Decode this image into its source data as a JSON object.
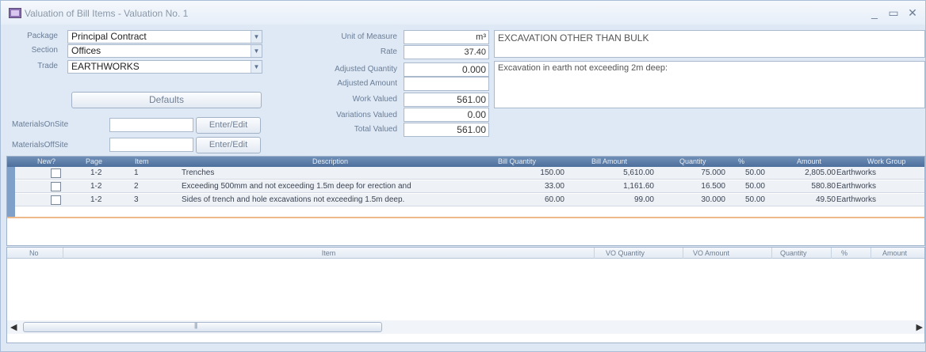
{
  "window": {
    "title": "Valuation of Bill Items - Valuation No. 1",
    "minimize": "_",
    "maximize": "▭",
    "close": "✕"
  },
  "form": {
    "package_label": "Package",
    "package_value": "Principal Contract",
    "section_label": "Section",
    "section_value": "Offices",
    "trade_label": "Trade",
    "trade_value": "EARTHWORKS",
    "defaults_button": "Defaults",
    "materials_onsite_label": "MaterialsOnSite",
    "materials_onsite_value": "",
    "materials_offsite_label": "MaterialsOffSite",
    "materials_offsite_value": "",
    "enter_edit_onsite": "Enter/Edit",
    "enter_edit_offsite": "Enter/Edit",
    "unit_label": "Unit of Measure",
    "unit_value": "m³",
    "rate_label": "Rate",
    "rate_value": "37.40",
    "adj_qty_label": "Adjusted Quantity",
    "adj_qty_value": "0.000",
    "adj_amt_label": "Adjusted Amount",
    "adj_amt_value": "",
    "work_valued_label": "Work Valued",
    "work_valued_value": "561.00",
    "variations_label": "Variations Valued",
    "variations_value": "0.00",
    "total_label": "Total Valued",
    "total_value": "561.00",
    "heading_text": "EXCAVATION OTHER THAN BULK",
    "description_text": "Excavation in earth not exceeding 2m deep:"
  },
  "bill_grid": {
    "columns": [
      "New?",
      "Page",
      "Item",
      "Description",
      "Bill Quantity",
      "Bill Amount",
      "Quantity",
      "%",
      "Amount",
      "Work Group"
    ],
    "rows": [
      {
        "page": "1-2",
        "item": "1",
        "description": "Trenches",
        "bill_qty": "150.00",
        "bill_amt": "5,610.00",
        "qty": "75.000",
        "pct": "50.00",
        "amount": "2,805.00",
        "work_group": "Earthworks"
      },
      {
        "page": "1-2",
        "item": "2",
        "description": "Exceeding 500mm and not exceeding 1.5m deep for erection and",
        "bill_qty": "33.00",
        "bill_amt": "1,161.60",
        "qty": "16.500",
        "pct": "50.00",
        "amount": "580.80",
        "work_group": "Earthworks"
      },
      {
        "page": "1-2",
        "item": "3",
        "description": "Sides of trench and hole excavations not exceeding 1.5m deep.",
        "bill_qty": "60.00",
        "bill_amt": "99.00",
        "qty": "30.000",
        "pct": "50.00",
        "amount": "49.50",
        "work_group": "Earthworks"
      }
    ]
  },
  "vo_grid": {
    "columns": [
      "No",
      "Item",
      "VO Quantity",
      "VO Amount",
      "Quantity",
      "%",
      "Amount"
    ],
    "scroll_left": "◀",
    "scroll_right": "▶"
  }
}
